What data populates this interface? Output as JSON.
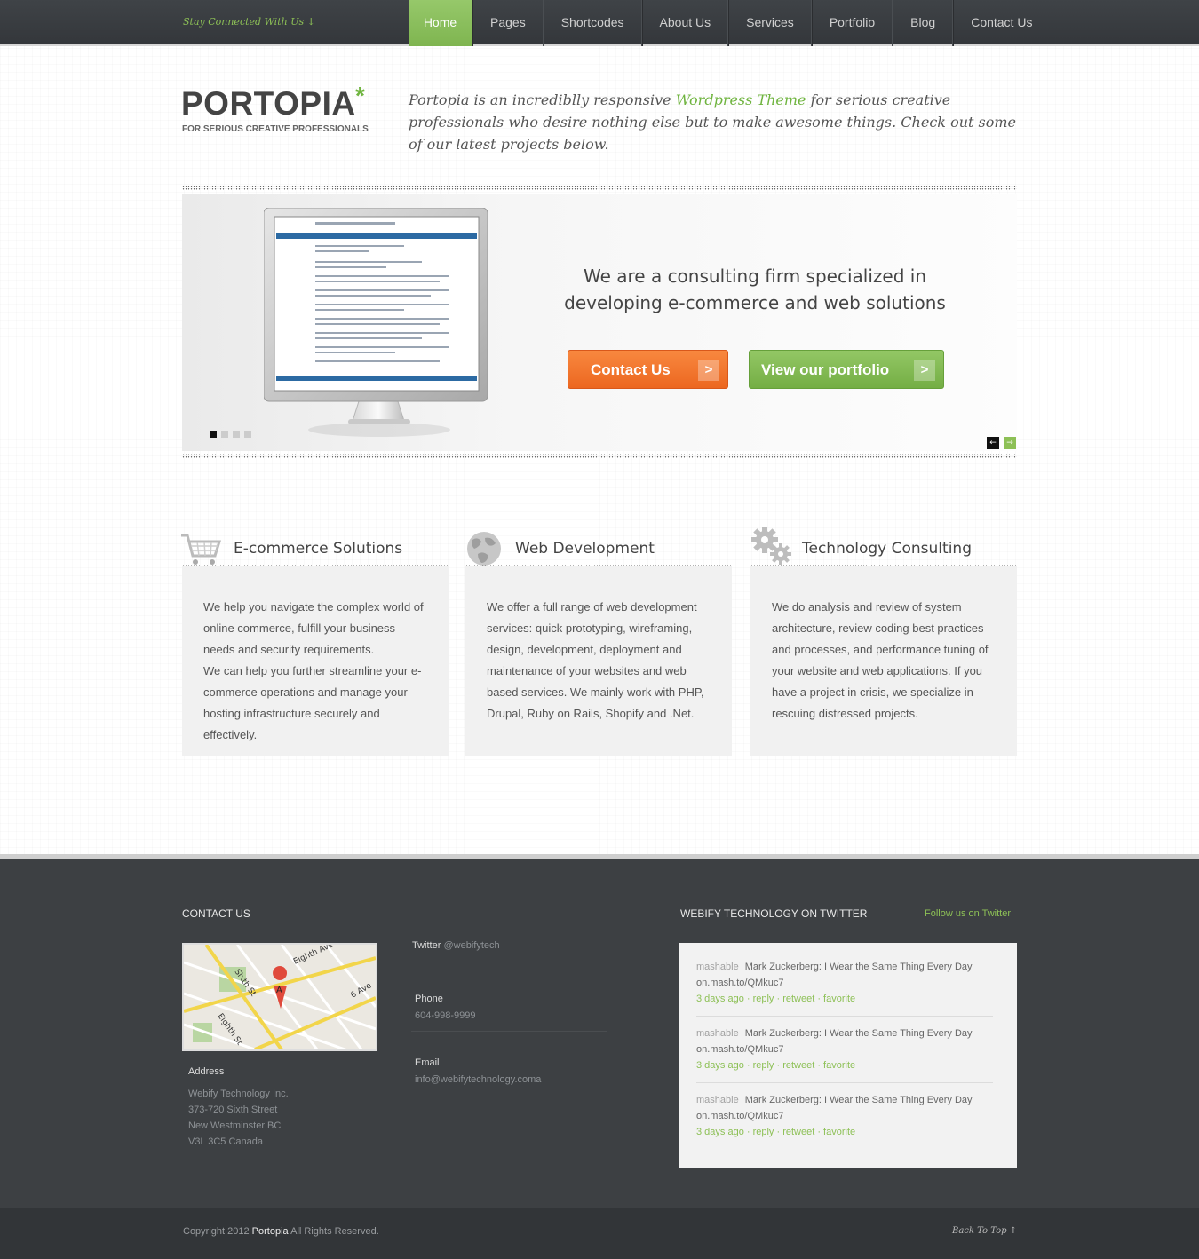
{
  "topbar": {
    "stay_connected": "Stay Connected With Us",
    "stay_arrow": "↓",
    "nav": [
      "Home",
      "Pages",
      "Shortcodes",
      "About Us",
      "Services",
      "Portfolio",
      "Blog",
      "Contact Us"
    ]
  },
  "header": {
    "logo": "PORTOPIA",
    "logo_star": "*",
    "tagline": "FOR SERIOUS CREATIVE PROFESSIONALS",
    "intro_before": "Portopia is an incrediblly responsive ",
    "intro_link": "Wordpress Theme",
    "intro_after": " for serious creative professionals who desire nothing else but to make awesome things. Check out some of our latest projects below."
  },
  "slider": {
    "heading": "We are a consulting firm specialized in developing e-commerce and web solutions",
    "contact_button": "Contact Us",
    "portfolio_button": "View our portfolio",
    "button_arrow": ">",
    "prev_arrow": "←",
    "next_arrow": "→",
    "active_slide": 1,
    "slide_count": 4
  },
  "services": [
    {
      "title": "E-commerce Solutions",
      "icon": "cart-icon",
      "text_1": "We help you navigate the complex world of online commerce, fulfill your business needs and security requirements.",
      "text_2": "We can help you further streamline your e-commerce operations and manage your hosting infrastructure securely and effectively."
    },
    {
      "title": "Web Development",
      "icon": "globe-icon",
      "text_1": "We offer a full range of web development services: quick prototyping, wireframing, design, development, deployment and maintenance of your websites and web based services. We mainly work with PHP, Drupal, Ruby on Rails, Shopify and .Net."
    },
    {
      "title": "Technology Consulting",
      "icon": "gears-icon",
      "text_1": "We do analysis and review of system architecture, review coding best practices and processes, and performance tuning of your website and web applications. If you have a project in crisis, we specialize in rescuing distressed projects."
    }
  ],
  "footer": {
    "contact_heading": "CONTACT US",
    "twitter_heading": "WEBIFY TECHNOLOGY ON TWITTER",
    "follow_link": "Follow us on Twitter",
    "map_streets": [
      "Sixth St",
      "Eighth Ave",
      "Eighth St",
      "6 Ave"
    ],
    "map_marker": "A",
    "address_label": "Address",
    "address_lines": [
      "Webify Technology Inc.",
      "373-720 Sixth Street",
      "New Westminster BC",
      "V3L 3C5 Canada"
    ],
    "twitter_label": "Twitter",
    "twitter_handle": "@webifytech",
    "phone_label": "Phone",
    "phone": "604-998-9999",
    "email_label": "Email",
    "email": "info@webifytechnology.coma",
    "tweets": [
      {
        "user": "mashable",
        "text": "Mark Zuckerberg: I Wear the Same Thing Every Day on.mash.to/QMkuc7",
        "meta": "3 days ago · reply · retweet · favorite"
      },
      {
        "user": "mashable",
        "text": "Mark Zuckerberg: I Wear the Same Thing Every Day on.mash.to/QMkuc7",
        "meta": "3 days ago · reply · retweet · favorite"
      },
      {
        "user": "mashable",
        "text": "Mark Zuckerberg: I Wear the Same Thing Every Day on.mash.to/QMkuc7",
        "meta": "3 days ago · reply · retweet · favorite"
      }
    ]
  },
  "bottombar": {
    "copyright_before": "Copyright 2012 ",
    "copyright_brand": "Portopia",
    "copyright_after": "  All Rights Reserved.",
    "back_to_top": "Back To Top",
    "back_arrow": "↑"
  },
  "colors": {
    "accent_green": "#8dc056",
    "accent_orange": "#ec6720",
    "dark_footer": "#3d4043"
  }
}
